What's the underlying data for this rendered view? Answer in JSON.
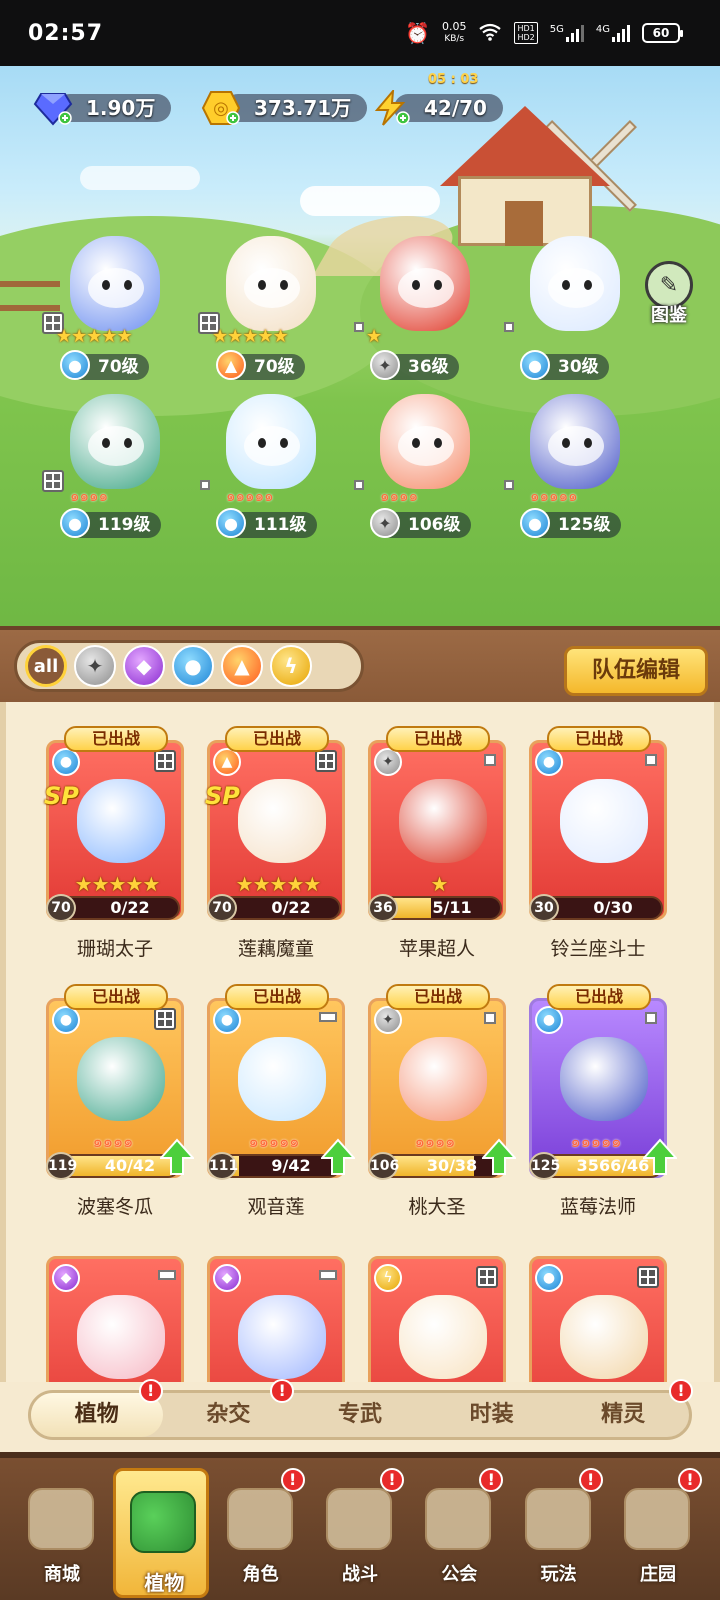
{
  "status_bar": {
    "time": "02:57",
    "net_speed_value": "0.05",
    "net_speed_unit": "KB/s",
    "hd1": "HD1",
    "hd2": "HD2",
    "sig1": "5G",
    "sig2": "4G",
    "battery": "60"
  },
  "resources": {
    "gems": "1.90万",
    "coins": "373.71万",
    "energy": "42/70",
    "energy_timer": "05 : 03"
  },
  "album_label": "图鉴",
  "heroes": [
    {
      "level": "70级",
      "element": "water",
      "rank": "stars",
      "count": 5,
      "color": "#6d8ff0"
    },
    {
      "level": "70级",
      "element": "fire",
      "rank": "stars",
      "count": 5,
      "color": "#f3dfc4"
    },
    {
      "level": "36级",
      "element": "sword",
      "rank": "stars",
      "count": 1,
      "color": "#e03a2a"
    },
    {
      "level": "30级",
      "element": "water",
      "rank": "none",
      "count": 0,
      "color": "#dbe9ff"
    },
    {
      "level": "119级",
      "element": "water",
      "rank": "flames",
      "count": 4,
      "color": "#3fa686"
    },
    {
      "level": "111级",
      "element": "water",
      "rank": "flames",
      "count": 5,
      "color": "#bde3ff"
    },
    {
      "level": "106级",
      "element": "sword",
      "rank": "flames",
      "count": 4,
      "color": "#f58b6a"
    },
    {
      "level": "125级",
      "element": "water",
      "rank": "flames",
      "count": 5,
      "color": "#4a58c8"
    }
  ],
  "filter_options": [
    "all",
    "sword",
    "poison",
    "water",
    "fire",
    "thunder"
  ],
  "team_edit_label": "队伍编辑",
  "cards": [
    {
      "name": "珊瑚太子",
      "status": "已出战",
      "level": "70",
      "progress": "0/22",
      "progress_ratio": 0,
      "element": "water",
      "rarity": "red",
      "rank": "stars",
      "count": 5,
      "sp": "SP",
      "upgrade": false,
      "color": "#86b6ff"
    },
    {
      "name": "莲藕魔童",
      "status": "已出战",
      "level": "70",
      "progress": "0/22",
      "progress_ratio": 0,
      "element": "fire",
      "rarity": "red",
      "rank": "stars",
      "count": 5,
      "sp": "SP",
      "upgrade": false,
      "color": "#f5e0c6"
    },
    {
      "name": "苹果超人",
      "status": "已出战",
      "level": "36",
      "progress": "5/11",
      "progress_ratio": 0.45,
      "element": "sword",
      "rarity": "red",
      "rank": "stars",
      "count": 1,
      "sp": "",
      "upgrade": false,
      "color": "#d8321f"
    },
    {
      "name": "铃兰座斗士",
      "status": "已出战",
      "level": "30",
      "progress": "0/30",
      "progress_ratio": 0,
      "element": "water",
      "rarity": "red",
      "rank": "none",
      "count": 0,
      "sp": "",
      "upgrade": false,
      "color": "#dfeaff"
    },
    {
      "name": "波塞冬瓜",
      "status": "已出战",
      "level": "119",
      "progress": "40/42",
      "progress_ratio": 0.95,
      "element": "water",
      "rarity": "gold",
      "rank": "flames",
      "count": 4,
      "sp": "",
      "upgrade": true,
      "color": "#3ea58a"
    },
    {
      "name": "观音莲",
      "status": "已出战",
      "level": "111",
      "progress": "9/42",
      "progress_ratio": 0.21,
      "element": "water",
      "rarity": "gold",
      "rank": "flames",
      "count": 5,
      "sp": "",
      "upgrade": true,
      "color": "#c6e6ff"
    },
    {
      "name": "桃大圣",
      "status": "已出战",
      "level": "106",
      "progress": "30/38",
      "progress_ratio": 0.79,
      "element": "sword",
      "rarity": "gold",
      "rank": "flames",
      "count": 4,
      "sp": "",
      "upgrade": true,
      "color": "#f48d6e"
    },
    {
      "name": "蓝莓法师",
      "status": "已出战",
      "level": "125",
      "progress": "3566/46",
      "progress_ratio": 1,
      "element": "water",
      "rarity": "purple",
      "rank": "flames",
      "count": 5,
      "sp": "",
      "upgrade": true,
      "color": "#4656c6"
    },
    {
      "name": "",
      "status": "",
      "level": "",
      "progress": "",
      "progress_ratio": 0,
      "element": "poison",
      "rarity": "red",
      "rank": "none",
      "count": 0,
      "sp": "",
      "upgrade": false,
      "color": "#f6b8c4"
    },
    {
      "name": "",
      "status": "",
      "level": "",
      "progress": "",
      "progress_ratio": 0,
      "element": "poison",
      "rarity": "red",
      "rank": "none",
      "count": 0,
      "sp": "",
      "upgrade": false,
      "color": "#9fb6ff"
    },
    {
      "name": "",
      "status": "",
      "level": "",
      "progress": "",
      "progress_ratio": 0,
      "element": "thunder",
      "rarity": "red",
      "rank": "none",
      "count": 0,
      "sp": "",
      "upgrade": false,
      "color": "#f8e2c0"
    },
    {
      "name": "",
      "status": "",
      "level": "",
      "progress": "",
      "progress_ratio": 0,
      "element": "water",
      "rarity": "red",
      "rank": "none",
      "count": 0,
      "sp": "",
      "upgrade": false,
      "color": "#f2d5a6"
    }
  ],
  "tabs": [
    {
      "label": "植物",
      "active": true,
      "badge": "!"
    },
    {
      "label": "杂交",
      "active": false,
      "badge": "!"
    },
    {
      "label": "专武",
      "active": false,
      "badge": ""
    },
    {
      "label": "时装",
      "active": false,
      "badge": ""
    },
    {
      "label": "精灵",
      "active": false,
      "badge": "!"
    }
  ],
  "nav": [
    {
      "label": "商城",
      "active": false,
      "badge": ""
    },
    {
      "label": "植物",
      "active": true,
      "badge": ""
    },
    {
      "label": "角色",
      "active": false,
      "badge": "!"
    },
    {
      "label": "战斗",
      "active": false,
      "badge": "!"
    },
    {
      "label": "公会",
      "active": false,
      "badge": "!"
    },
    {
      "label": "玩法",
      "active": false,
      "badge": "!"
    },
    {
      "label": "庄园",
      "active": false,
      "badge": "!"
    }
  ],
  "colors": {
    "accent_gold": "#f4b82b",
    "badge_red": "#e82a2a",
    "wood_brown": "#8a5a38"
  }
}
